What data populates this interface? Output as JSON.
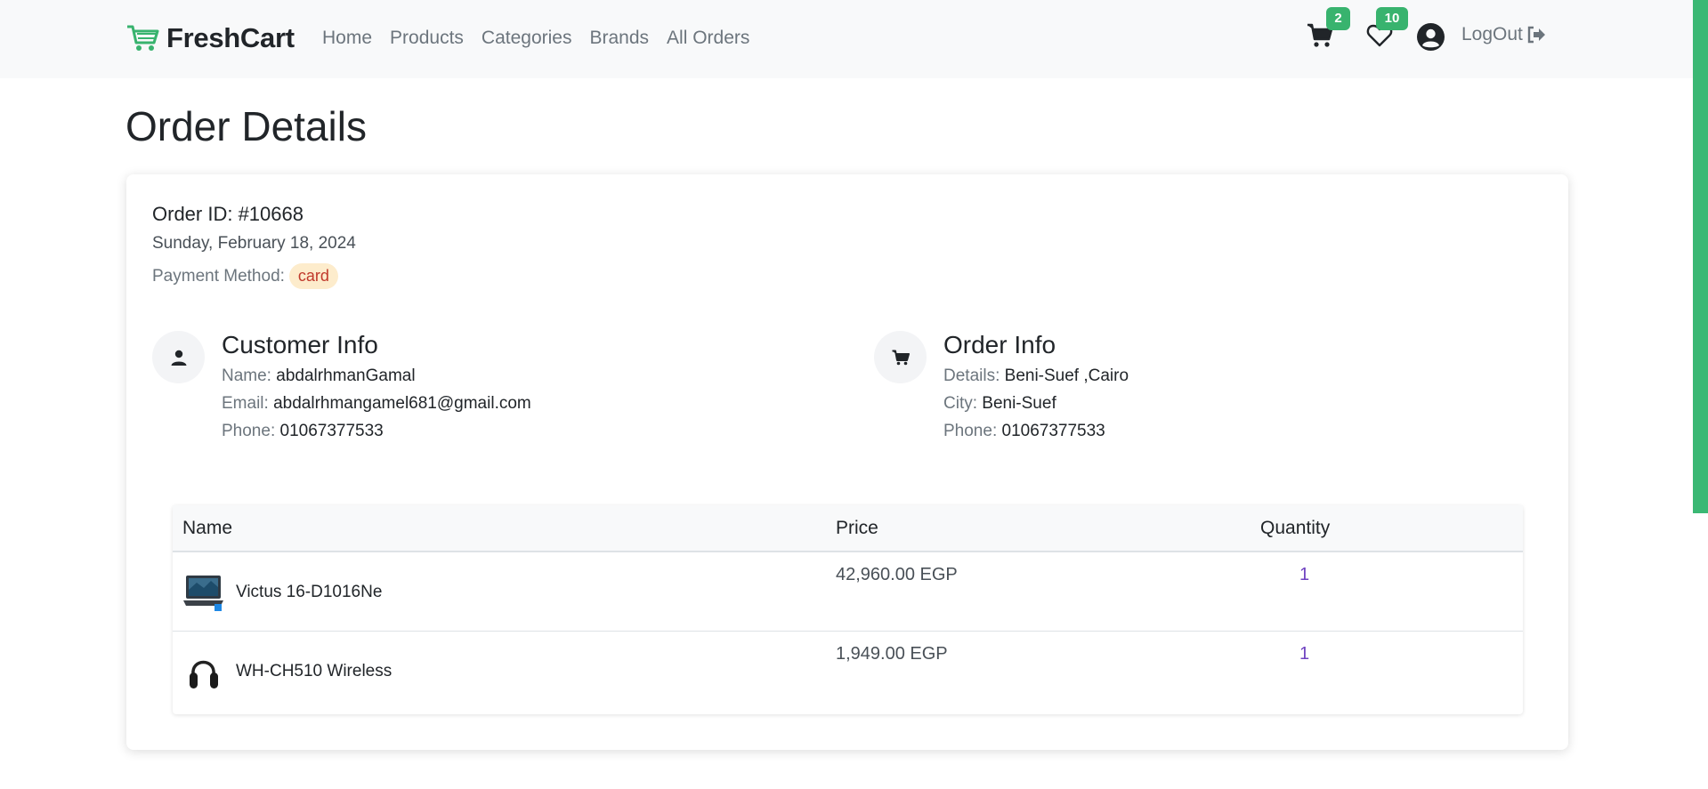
{
  "brand": {
    "name": "FreshCart",
    "accent": "#38b36e"
  },
  "nav": {
    "links": [
      "Home",
      "Products",
      "Categories",
      "Brands",
      "All Orders"
    ],
    "cart_count": "2",
    "wishlist_count": "10",
    "logout_label": "LogOut"
  },
  "page": {
    "title": "Order Details"
  },
  "order": {
    "id": "Order ID: #10668",
    "date": "Sunday, February 18, 2024",
    "payment_label": "Payment Method:",
    "payment_method": "card"
  },
  "customer": {
    "title": "Customer Info",
    "name_label": "Name:",
    "name": "abdalrhmanGamal",
    "email_label": "Email:",
    "email": "abdalrhmangamel681@gmail.com",
    "phone_label": "Phone:",
    "phone": "01067377533"
  },
  "order_info": {
    "title": "Order Info",
    "details_label": "Details:",
    "details": "Beni-Suef ,Cairo",
    "city_label": "City:",
    "city": "Beni-Suef",
    "phone_label": "Phone:",
    "phone": "01067377533"
  },
  "table": {
    "headers": {
      "name": "Name",
      "price": "Price",
      "quantity": "Quantity"
    },
    "rows": [
      {
        "name": "Victus 16-D1016Ne",
        "price": "42,960.00 EGP",
        "quantity": "1",
        "icon": "laptop-icon"
      },
      {
        "name": "WH-CH510 Wireless",
        "price": "1,949.00 EGP",
        "quantity": "1",
        "icon": "headphones-icon"
      }
    ]
  }
}
